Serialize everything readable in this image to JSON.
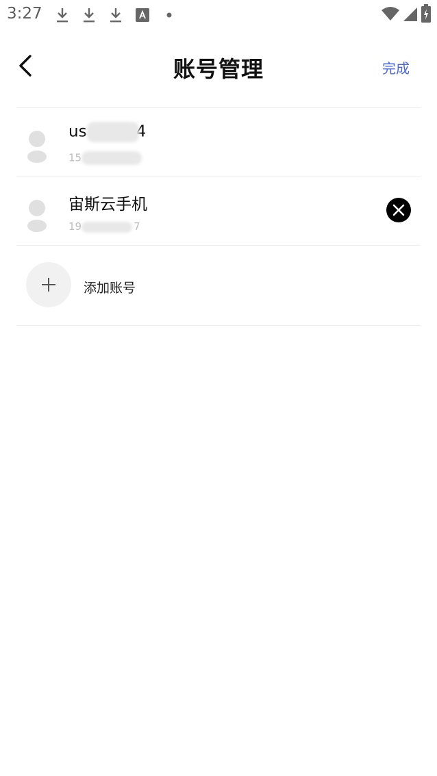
{
  "status_bar": {
    "time": "3:27",
    "icons": [
      "download-icon",
      "download-icon",
      "download-icon",
      "font-a-icon",
      "dot-icon",
      "wifi-icon",
      "signal-icon",
      "battery-charging-icon"
    ]
  },
  "header": {
    "title": "账号管理",
    "done_label": "完成"
  },
  "accounts": [
    {
      "name_prefix": "us",
      "name_suffix": "4",
      "phone_prefix": "15",
      "phone_suffix": "",
      "removable": false
    },
    {
      "name": "宙斯云手机",
      "phone_prefix": "19",
      "phone_suffix": "7",
      "removable": true
    }
  ],
  "add_account": {
    "label": "添加账号"
  },
  "colors": {
    "accent": "#4a67e6",
    "divider": "#ececf2",
    "avatar": "#e0e0e0"
  }
}
